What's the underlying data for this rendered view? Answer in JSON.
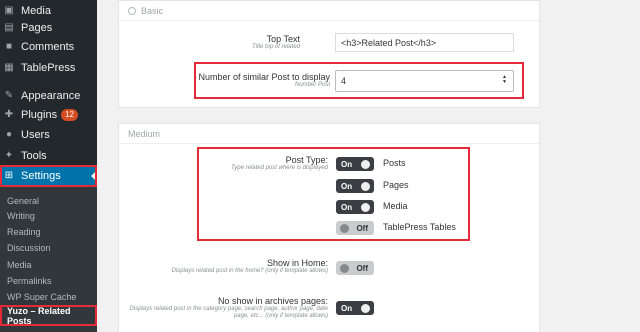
{
  "sidebar": {
    "menu": [
      {
        "label": "Media",
        "icon": "media-icon"
      },
      {
        "label": "Pages",
        "icon": "pages-icon"
      },
      {
        "label": "Comments",
        "icon": "comments-icon"
      },
      {
        "label": "TablePress",
        "icon": "tablepress-icon"
      },
      {
        "label": "Appearance",
        "icon": "appearance-icon"
      },
      {
        "label": "Plugins",
        "icon": "plugins-icon",
        "badge": "12"
      },
      {
        "label": "Users",
        "icon": "users-icon"
      },
      {
        "label": "Tools",
        "icon": "tools-icon"
      },
      {
        "label": "Settings",
        "icon": "settings-icon"
      }
    ],
    "submenu": [
      "General",
      "Writing",
      "Reading",
      "Discussion",
      "Media",
      "Permalinks",
      "WP Super Cache",
      "Yuzo – Related Posts"
    ]
  },
  "basic": {
    "title": "Basic",
    "top_text_label": "Top Text",
    "top_text_desc": "Title top of related",
    "top_text_value": "<h3>Related Post</h3>",
    "number_label": "Number of similar Post to display",
    "number_desc": "Number Post",
    "number_value": "4"
  },
  "medium": {
    "title": "Medium",
    "post_type_label": "Post Type:",
    "post_type_desc": "Type related post where is displayed",
    "post_types": [
      {
        "state": "On",
        "label": "Posts"
      },
      {
        "state": "On",
        "label": "Pages"
      },
      {
        "state": "On",
        "label": "Media"
      },
      {
        "state": "Off",
        "label": "TablePress Tables"
      }
    ],
    "show_home_label": "Show in Home:",
    "show_home_desc": "Displays related post in the home? (only if template allows)",
    "show_home_state": "Off",
    "archives_label": "No show in archives pages:",
    "archives_desc": "Displays related post in the category page, search page, author page, date page, etc... (only if template allows)",
    "archives_state": "On"
  },
  "colors": {
    "sidebar_bg": "#23282d",
    "active": "#0073aa",
    "highlight": "#e52b3a"
  }
}
